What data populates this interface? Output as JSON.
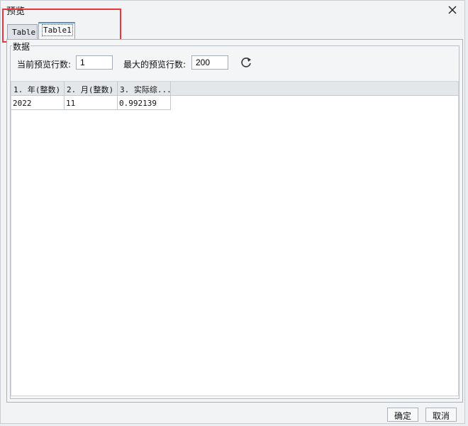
{
  "window": {
    "title": "预览"
  },
  "tabs": [
    {
      "label": "Table"
    },
    {
      "label": "Table1"
    }
  ],
  "group": {
    "title": "数据"
  },
  "toolbar": {
    "current_rows_label": "当前预览行数:",
    "current_rows_value": "1",
    "max_rows_label": "最大的预览行数:",
    "max_rows_value": "200"
  },
  "table": {
    "columns": [
      "1. 年(整数)",
      "2. 月(整数)",
      "3. 实际综..."
    ],
    "rows": [
      [
        "2022",
        "11",
        "0.992139"
      ]
    ]
  },
  "buttons": {
    "ok": "确定",
    "cancel": "取消"
  }
}
